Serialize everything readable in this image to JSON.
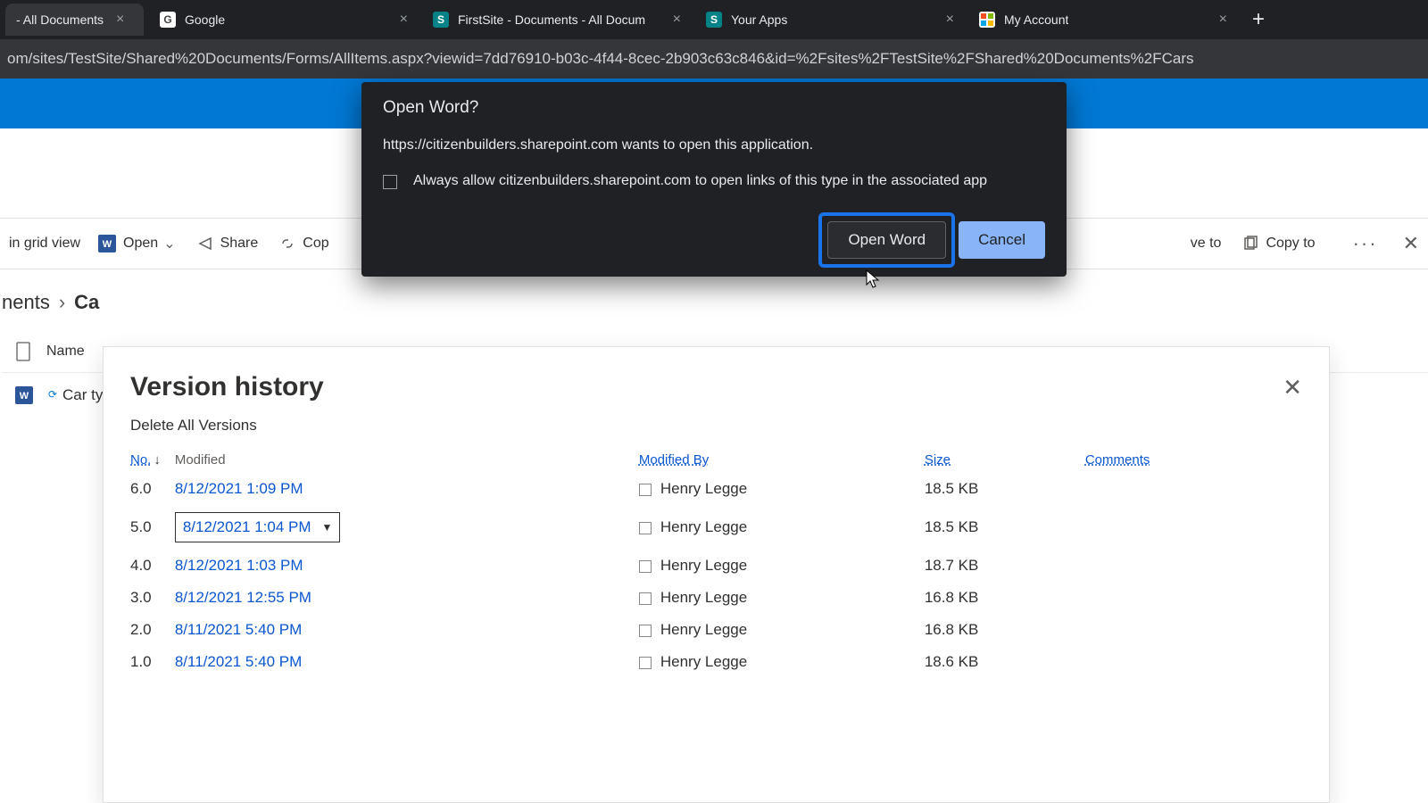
{
  "tabs": [
    {
      "title": "- All Documents",
      "favicon": "sp"
    },
    {
      "title": "Google",
      "favicon": "g"
    },
    {
      "title": "FirstSite - Documents - All Docum",
      "favicon": "sp"
    },
    {
      "title": "Your Apps",
      "favicon": "sp"
    },
    {
      "title": "My Account",
      "favicon": "ms"
    }
  ],
  "url": "om/sites/TestSite/Shared%20Documents/Forms/AllItems.aspx?viewid=7dd76910-b03c-4f44-8cec-2b903c63c846&id=%2Fsites%2FTestSite%2FShared%20Documents%2FCars",
  "cmdbar": {
    "grid_view": "in grid view",
    "open": "Open",
    "share": "Share",
    "copy_link": "Cop",
    "move_to": "ve to",
    "copy_to": "Copy to"
  },
  "breadcrumb": {
    "parent": "nents",
    "current": "Ca"
  },
  "columns": {
    "name": "Name"
  },
  "filerow": {
    "name": "Car typ"
  },
  "dialog": {
    "title": "Open Word?",
    "body": "https://citizenbuilders.sharepoint.com wants to open this application.",
    "always": "Always allow citizenbuilders.sharepoint.com to open links of this type in the associated app",
    "open": "Open Word",
    "cancel": "Cancel"
  },
  "version_history": {
    "title": "Version history",
    "delete_all": "Delete All Versions",
    "headers": {
      "no": "No.",
      "modified": "Modified",
      "modified_by": "Modified By",
      "size": "Size",
      "comments": "Comments"
    },
    "rows": [
      {
        "no": "6.0",
        "modified": "8/12/2021 1:09 PM",
        "by": "Henry Legge",
        "size": "18.5 KB",
        "selected": false
      },
      {
        "no": "5.0",
        "modified": "8/12/2021 1:04 PM",
        "by": "Henry Legge",
        "size": "18.5 KB",
        "selected": true
      },
      {
        "no": "4.0",
        "modified": "8/12/2021 1:03 PM",
        "by": "Henry Legge",
        "size": "18.7 KB",
        "selected": false
      },
      {
        "no": "3.0",
        "modified": "8/12/2021 12:55 PM",
        "by": "Henry Legge",
        "size": "16.8 KB",
        "selected": false
      },
      {
        "no": "2.0",
        "modified": "8/11/2021 5:40 PM",
        "by": "Henry Legge",
        "size": "16.8 KB",
        "selected": false
      },
      {
        "no": "1.0",
        "modified": "8/11/2021 5:40 PM",
        "by": "Henry Legge",
        "size": "18.6 KB",
        "selected": false
      }
    ]
  }
}
